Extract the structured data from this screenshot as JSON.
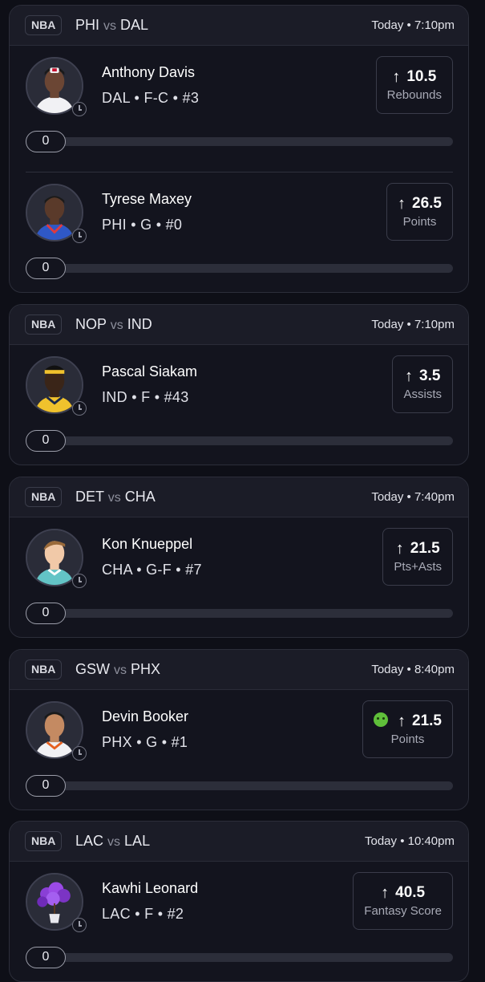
{
  "games": [
    {
      "league": "NBA",
      "away": "PHI",
      "vs": "vs",
      "home": "DAL",
      "time": "Today • 7:10pm",
      "players": [
        {
          "name": "Anthony Davis",
          "meta": "DAL • F-C • #3",
          "line": "10.5",
          "stat": "Rebounds",
          "progress": "0",
          "direction_icon": "arrow-up-icon",
          "jersey_color": "#f1f1f4"
        },
        {
          "name": "Tyrese Maxey",
          "meta": "PHI • G • #0",
          "line": "26.5",
          "stat": "Points",
          "progress": "0",
          "direction_icon": "arrow-up-icon",
          "jersey_color": "#2f58c6"
        }
      ]
    },
    {
      "league": "NBA",
      "away": "NOP",
      "vs": "vs",
      "home": "IND",
      "time": "Today • 7:10pm",
      "players": [
        {
          "name": "Pascal Siakam",
          "meta": "IND • F • #43",
          "line": "3.5",
          "stat": "Assists",
          "progress": "0",
          "direction_icon": "arrow-up-icon",
          "jersey_color": "#f0c22d"
        }
      ]
    },
    {
      "league": "NBA",
      "away": "DET",
      "vs": "vs",
      "home": "CHA",
      "time": "Today • 7:40pm",
      "players": [
        {
          "name": "Kon Knueppel",
          "meta": "CHA • G-F • #7",
          "line": "21.5",
          "stat": "Pts+Asts",
          "progress": "0",
          "direction_icon": "arrow-up-icon",
          "jersey_color": "#63c4c6"
        }
      ]
    },
    {
      "league": "NBA",
      "away": "GSW",
      "vs": "vs",
      "home": "PHX",
      "time": "Today • 8:40pm",
      "players": [
        {
          "name": "Devin Booker",
          "meta": "PHX • G • #1",
          "line": "21.5",
          "stat": "Points",
          "progress": "0",
          "direction_icon": "arrow-up-icon",
          "badge_icon": "green-devil-emoji-icon",
          "jersey_color": "#f1f1f4"
        }
      ]
    },
    {
      "league": "NBA",
      "away": "LAC",
      "vs": "vs",
      "home": "LAL",
      "time": "Today • 10:40pm",
      "players": [
        {
          "name": "Kawhi Leonard",
          "meta": "LAC • F • #2",
          "line": "40.5",
          "stat": "Fantasy Score",
          "progress": "0",
          "direction_icon": "arrow-up-icon",
          "avatar_icon": "purple-flower-plant-icon"
        }
      ]
    }
  ],
  "colors": {
    "background": "#0e0f17",
    "card": "#13141e",
    "header": "#1b1c27",
    "track": "#2c2e3a"
  }
}
